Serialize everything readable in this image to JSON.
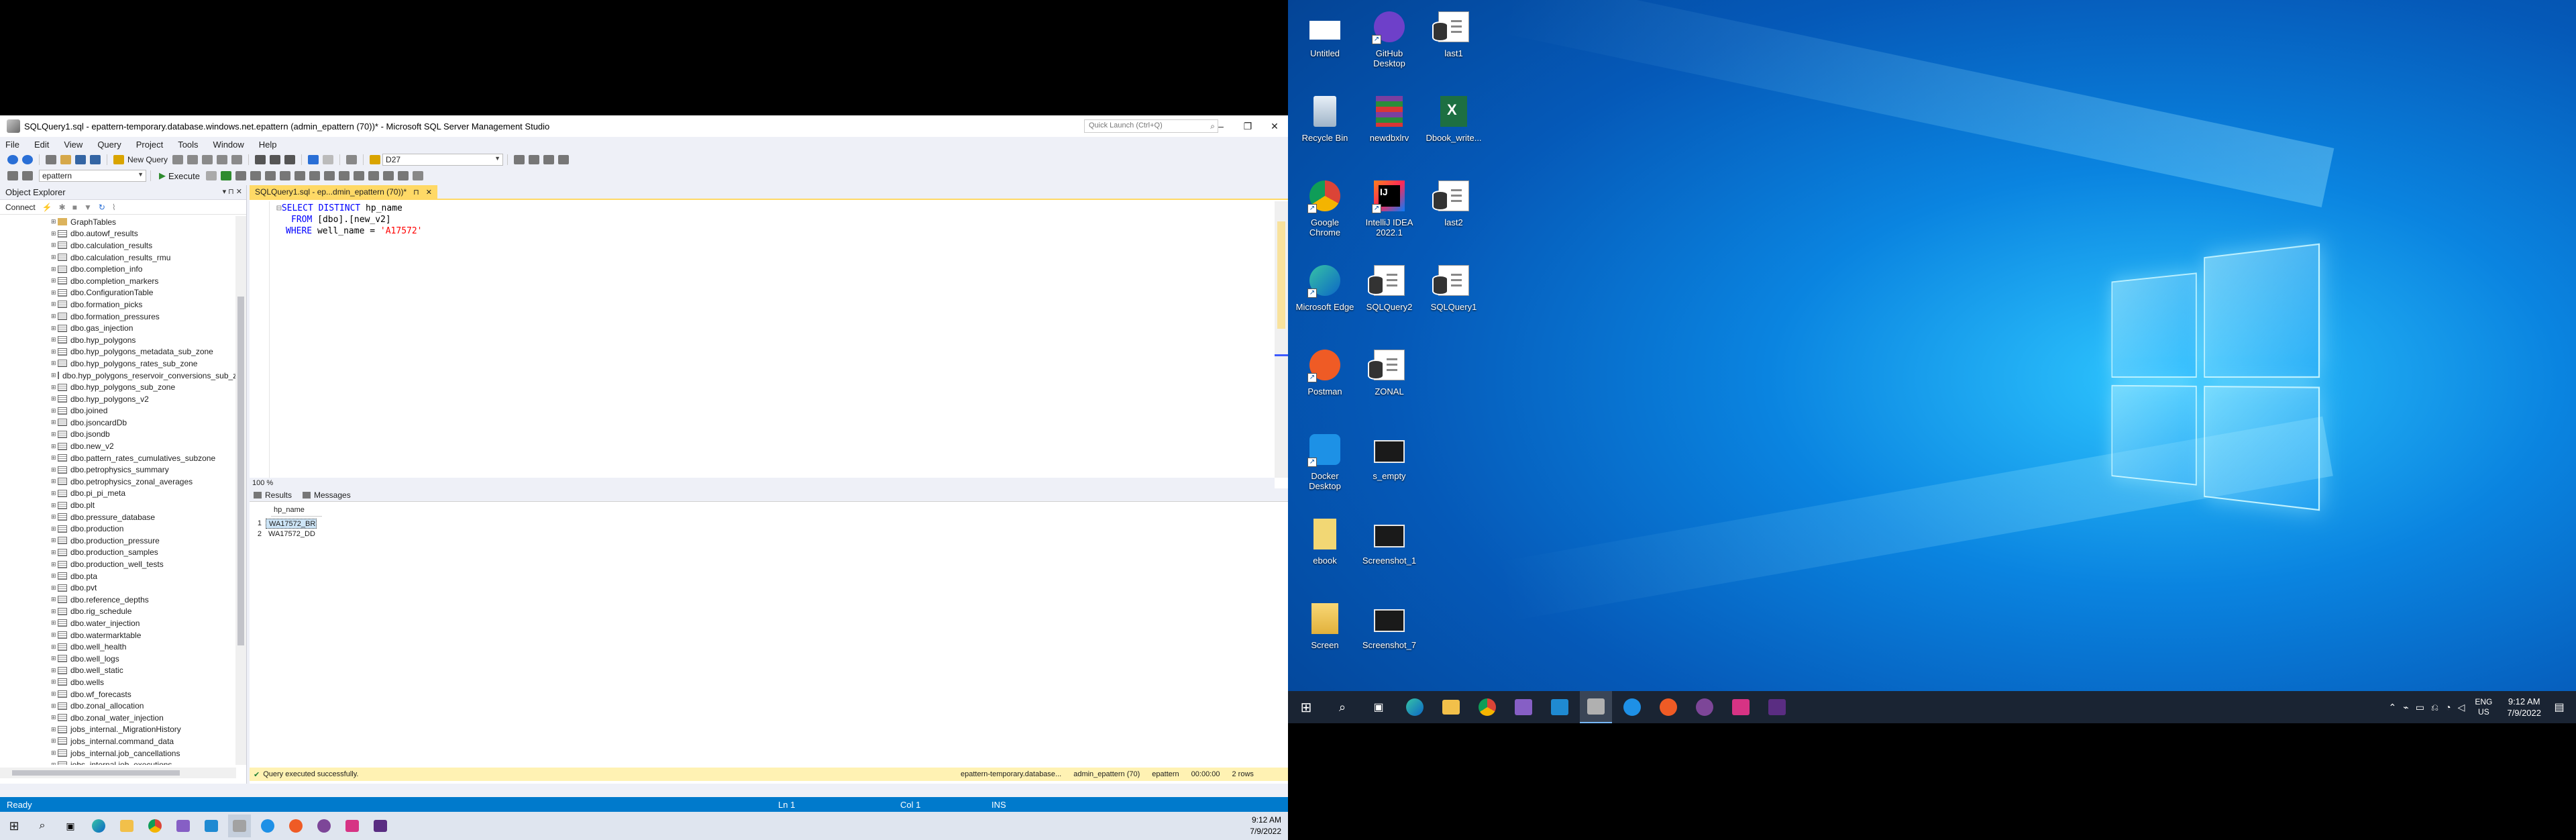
{
  "ssms": {
    "title": "SQLQuery1.sql - epattern-temporary.database.windows.net.epattern (admin_epattern (70))* - Microsoft SQL Server Management Studio",
    "quick_launch_placeholder": "Quick Launch (Ctrl+Q)",
    "menu": [
      "File",
      "Edit",
      "View",
      "Query",
      "Project",
      "Tools",
      "Window",
      "Help"
    ],
    "toolbar": {
      "new_query": "New Query",
      "location_combo": "D27",
      "database_combo": "epattern",
      "execute": "Execute"
    },
    "object_explorer": {
      "title": "Object Explorer",
      "connect": "Connect",
      "items": [
        "GraphTables",
        "dbo.autowf_results",
        "dbo.calculation_results",
        "dbo.calculation_results_rmu",
        "dbo.completion_info",
        "dbo.completion_markers",
        "dbo.ConfigurationTable",
        "dbo.formation_picks",
        "dbo.formation_pressures",
        "dbo.gas_injection",
        "dbo.hyp_polygons",
        "dbo.hyp_polygons_metadata_sub_zone",
        "dbo.hyp_polygons_rates_sub_zone",
        "dbo.hyp_polygons_reservoir_conversions_sub_z",
        "dbo.hyp_polygons_sub_zone",
        "dbo.hyp_polygons_v2",
        "dbo.joined",
        "dbo.jsoncardDb",
        "dbo.jsondb",
        "dbo.new_v2",
        "dbo.pattern_rates_cumulatives_subzone",
        "dbo.petrophysics_summary",
        "dbo.petrophysics_zonal_averages",
        "dbo.pi_pi_meta",
        "dbo.plt",
        "dbo.pressure_database",
        "dbo.production",
        "dbo.production_pressure",
        "dbo.production_samples",
        "dbo.production_well_tests",
        "dbo.pta",
        "dbo.pvt",
        "dbo.reference_depths",
        "dbo.rig_schedule",
        "dbo.water_injection",
        "dbo.watermarktable",
        "dbo.well_health",
        "dbo.well_logs",
        "dbo.well_static",
        "dbo.wells",
        "dbo.wf_forecasts",
        "dbo.zonal_allocation",
        "dbo.zonal_water_injection",
        "jobs_internal._MigrationHistory",
        "jobs_internal.command_data",
        "jobs_internal.job_cancellations",
        "jobs_internal.job_executions"
      ]
    },
    "editor": {
      "tab_label": "SQLQuery1.sql - ep...dmin_epattern (70))*",
      "code": {
        "line1_kw": "SELECT DISTINCT",
        "line1_rest": " hp_name",
        "line2_kw": "FROM",
        "line2_rest": " [dbo].[new_v2]",
        "line3_kw": "WHERE",
        "line3_rest": " well_name = ",
        "line3_str": "'A17572'"
      },
      "zoom": "100 %"
    },
    "results": {
      "tabs": [
        "Results",
        "Messages"
      ],
      "column": "hp_name",
      "rows": [
        "WA17572_BR",
        "WA17572_DD"
      ],
      "row_numbers": [
        "1",
        "2"
      ]
    },
    "query_status": {
      "message": "Query executed successfully.",
      "server": "epattern-temporary.database...",
      "user": "admin_epattern (70)",
      "database": "epattern",
      "elapsed": "00:00:00",
      "rows": "2 rows"
    },
    "statusbar": {
      "state": "Ready",
      "ln": "Ln 1",
      "col": "Col 1",
      "ins": "INS"
    },
    "taskbar_clock": {
      "time": "9:12 AM",
      "date": "7/9/2022"
    }
  },
  "desktop": {
    "icons": [
      {
        "label": "Untitled",
        "icon": "blank-document-icon"
      },
      {
        "label": "GitHub Desktop",
        "icon": "github-icon"
      },
      {
        "label": "last1",
        "icon": "sql-file-icon"
      },
      {
        "label": "Recycle Bin",
        "icon": "recycle-bin-icon"
      },
      {
        "label": "newdbxlrv",
        "icon": "winrar-icon"
      },
      {
        "label": "Dbook_write...",
        "icon": "excel-icon"
      },
      {
        "label": "Google Chrome",
        "icon": "chrome-icon"
      },
      {
        "label": "IntelliJ IDEA 2022.1",
        "icon": "intellij-icon"
      },
      {
        "label": "last2",
        "icon": "sql-file-icon"
      },
      {
        "label": "Microsoft Edge",
        "icon": "edge-icon"
      },
      {
        "label": "SQLQuery2",
        "icon": "sql-file-icon"
      },
      {
        "label": "SQLQuery1",
        "icon": "sql-file-icon"
      },
      {
        "label": "Postman",
        "icon": "postman-icon"
      },
      {
        "label": "ZONAL",
        "icon": "sql-file-icon"
      },
      {
        "label": "Docker Desktop",
        "icon": "docker-icon"
      },
      {
        "label": "s_empty",
        "icon": "image-file-icon"
      },
      {
        "label": "ebook",
        "icon": "ebook-icon"
      },
      {
        "label": "Screenshot_1",
        "icon": "image-file-icon"
      },
      {
        "label": "Screen",
        "icon": "folder-icon"
      },
      {
        "label": "Screenshot_7",
        "icon": "image-file-icon"
      }
    ],
    "taskbar": {
      "lang_top": "ENG",
      "lang_bottom": "US",
      "time": "9:12 AM",
      "date": "7/9/2022"
    }
  },
  "colors": {
    "accent": "#007acc",
    "tab_yellow": "#ffd966",
    "desktop_blue": "#0a84e0"
  }
}
